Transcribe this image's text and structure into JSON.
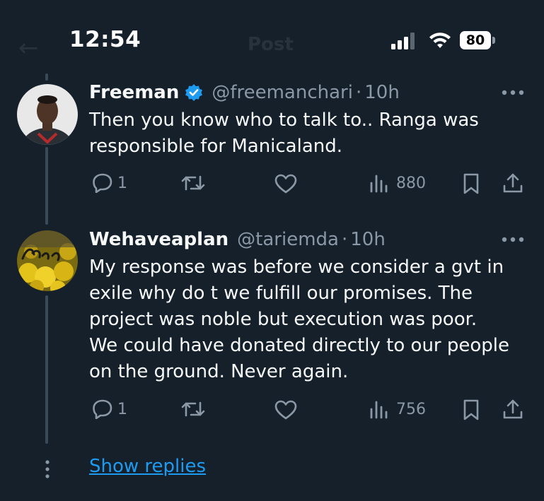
{
  "status_bar": {
    "time": "12:54",
    "battery": "80",
    "ghost_title": "Post"
  },
  "tweets": [
    {
      "author": "Freeman",
      "verified": true,
      "handle": "@freemanchari",
      "separator": "·",
      "time": "10h",
      "text_lines": [
        "Then you know who to talk to.. Ranga was",
        "responsible for Manicaland."
      ],
      "replies": "1",
      "views": "880"
    },
    {
      "author": "Wehaveaplan",
      "verified": false,
      "handle": "@tariemda",
      "separator": "·",
      "time": "10h",
      "text_lines": [
        "My response was before we consider a gvt in",
        "exile why do t we fulfill our promises. The",
        "project was noble but execution  was poor.",
        "We could have donated directly to our people",
        "on the ground. Never again."
      ],
      "replies": "1",
      "views": "756"
    }
  ],
  "show_replies_label": "Show replies",
  "colors": {
    "background": "#15202b",
    "text": "#f7f9f9",
    "secondary": "#8b98a5",
    "accent": "#1d9bf0"
  },
  "icons": [
    "comment-icon",
    "retweet-icon",
    "like-icon",
    "views-icon",
    "bookmark-icon",
    "share-icon",
    "verified-badge-icon",
    "more-icon"
  ]
}
